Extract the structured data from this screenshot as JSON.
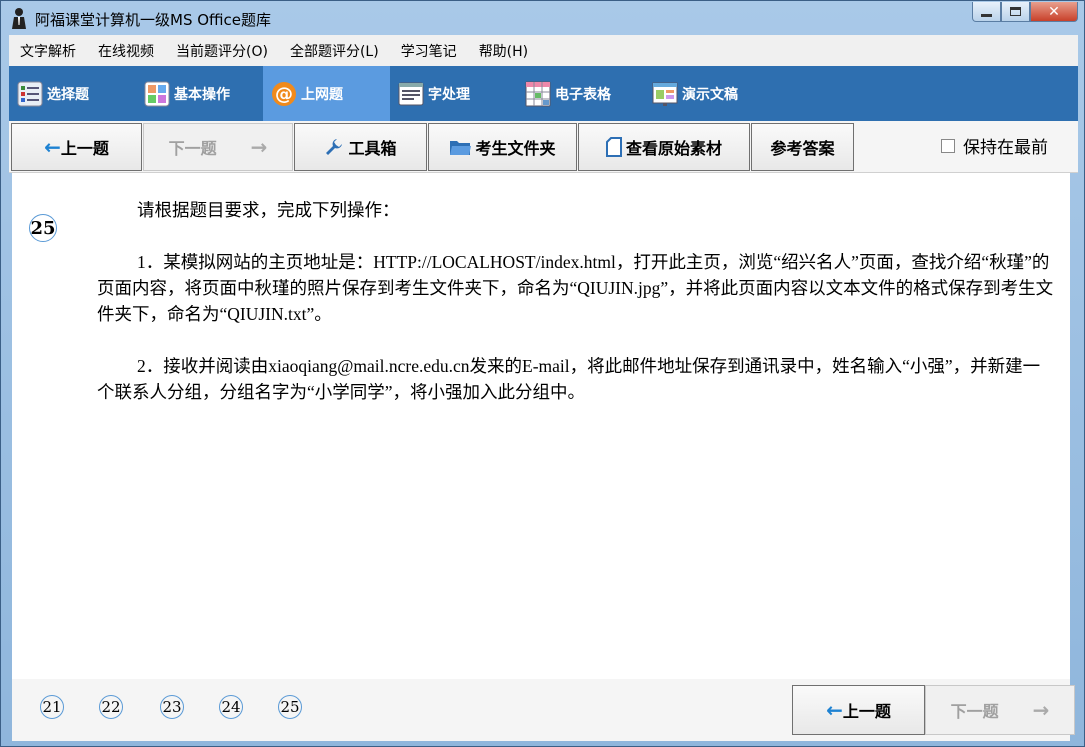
{
  "window": {
    "title": "阿福课堂计算机一级MS Office题库"
  },
  "menu": [
    "文字解析",
    "在线视频",
    "当前题评分(O)",
    "全部题评分(L)",
    "学习笔记",
    "帮助(H)"
  ],
  "categories": [
    {
      "label": "选择题",
      "icon": "list-icon"
    },
    {
      "label": "基本操作",
      "icon": "grid-icon"
    },
    {
      "label": "上网题",
      "icon": "at-sign-icon"
    },
    {
      "label": "字处理",
      "icon": "document-icon"
    },
    {
      "label": "电子表格",
      "icon": "spreadsheet-icon"
    },
    {
      "label": "演示文稿",
      "icon": "presentation-icon"
    }
  ],
  "toolbar": {
    "prev": "上一题",
    "next": "下一题",
    "toolbox": "工具箱",
    "student_folder": "考生文件夹",
    "view_material": "查看原始素材",
    "answer": "参考答案",
    "keep_on_top": "保持在最前"
  },
  "question": {
    "number": "25",
    "intro": "请根据题目要求，完成下列操作：",
    "items": [
      "1．某模拟网站的主页地址是：HTTP://LOCALHOST/index.html，打开此主页，浏览“绍兴名人”页面，查找介绍“秋瑾”的页面内容，将页面中秋瑾的照片保存到考生文件夹下，命名为“QIUJIN.jpg”，并将此页面内容以文本文件的格式保存到考生文件夹下，命名为“QIUJIN.txt”。",
      "2．接收并阅读由xiaoqiang@mail.ncre.edu.cn发来的E-mail，将此邮件地址保存到通讯录中，姓名输入“小强”，并新建一个联系人分组，分组名字为“小学同学”，将小强加入此分组中。"
    ]
  },
  "footer": {
    "pages": [
      "21",
      "22",
      "23",
      "24",
      "25"
    ],
    "prev": "上一题",
    "next": "下一题"
  }
}
